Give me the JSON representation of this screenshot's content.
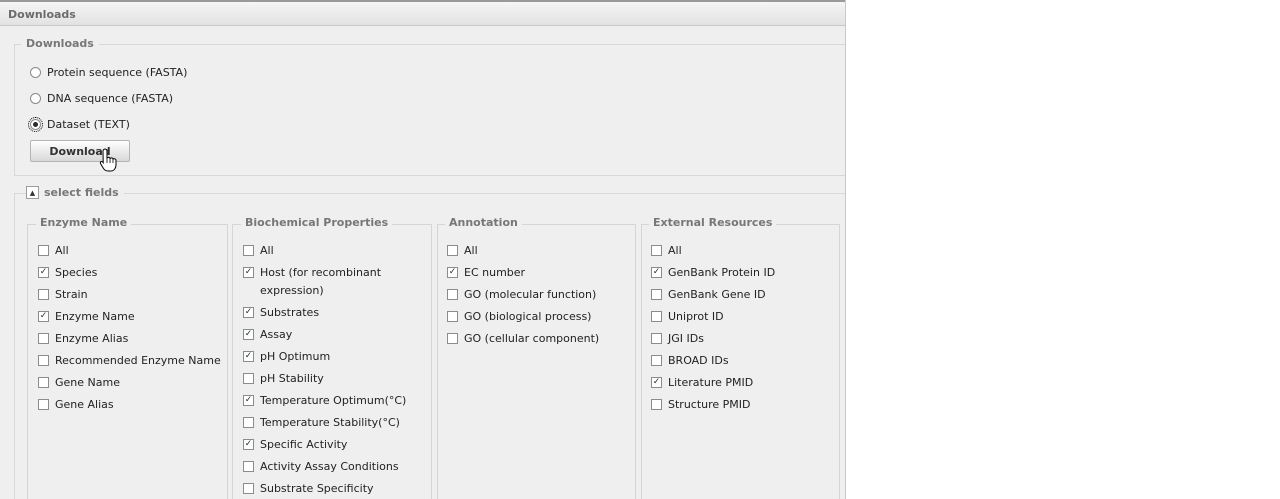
{
  "panel": {
    "title": "Downloads"
  },
  "downloads": {
    "legend": "Downloads",
    "options": [
      {
        "label": "Protein sequence (FASTA)",
        "checked": false
      },
      {
        "label": "DNA sequence (FASTA)",
        "checked": false
      },
      {
        "label": "Dataset (TEXT)",
        "checked": true
      }
    ],
    "button_label": "Download"
  },
  "select_fields": {
    "legend": "select fields",
    "toggle_icon": "collapse-up-arrow",
    "columns": [
      {
        "title": "Enzyme Name",
        "items": [
          {
            "label": "All",
            "checked": false
          },
          {
            "label": "Species",
            "checked": true
          },
          {
            "label": "Strain",
            "checked": false
          },
          {
            "label": "Enzyme Name",
            "checked": true
          },
          {
            "label": "Enzyme Alias",
            "checked": false
          },
          {
            "label": "Recommended Enzyme Name",
            "checked": false
          },
          {
            "label": "Gene Name",
            "checked": false
          },
          {
            "label": "Gene Alias",
            "checked": false
          }
        ]
      },
      {
        "title": "Biochemical Properties",
        "items": [
          {
            "label": "All",
            "checked": false
          },
          {
            "label": "Host (for recombinant expression)",
            "checked": true
          },
          {
            "label": "Substrates",
            "checked": true
          },
          {
            "label": "Assay",
            "checked": true
          },
          {
            "label": "pH Optimum",
            "checked": true
          },
          {
            "label": "pH Stability",
            "checked": false
          },
          {
            "label": "Temperature Optimum(°C)",
            "checked": true
          },
          {
            "label": "Temperature Stability(°C)",
            "checked": false
          },
          {
            "label": "Specific Activity",
            "checked": true
          },
          {
            "label": "Activity Assay Conditions",
            "checked": false
          },
          {
            "label": "Substrate Specificity",
            "checked": false
          }
        ]
      },
      {
        "title": "Annotation",
        "items": [
          {
            "label": "All",
            "checked": false
          },
          {
            "label": "EC number",
            "checked": true
          },
          {
            "label": "GO (molecular function)",
            "checked": false
          },
          {
            "label": "GO (biological process)",
            "checked": false
          },
          {
            "label": "GO (cellular component)",
            "checked": false
          }
        ]
      },
      {
        "title": "External Resources",
        "items": [
          {
            "label": "All",
            "checked": false
          },
          {
            "label": "GenBank Protein ID",
            "checked": true
          },
          {
            "label": "GenBank Gene ID",
            "checked": false
          },
          {
            "label": "Uniprot ID",
            "checked": false
          },
          {
            "label": "JGI IDs",
            "checked": false
          },
          {
            "label": "BROAD IDs",
            "checked": false
          },
          {
            "label": "Literature PMID",
            "checked": true
          },
          {
            "label": "Structure PMID",
            "checked": false
          }
        ]
      }
    ]
  }
}
